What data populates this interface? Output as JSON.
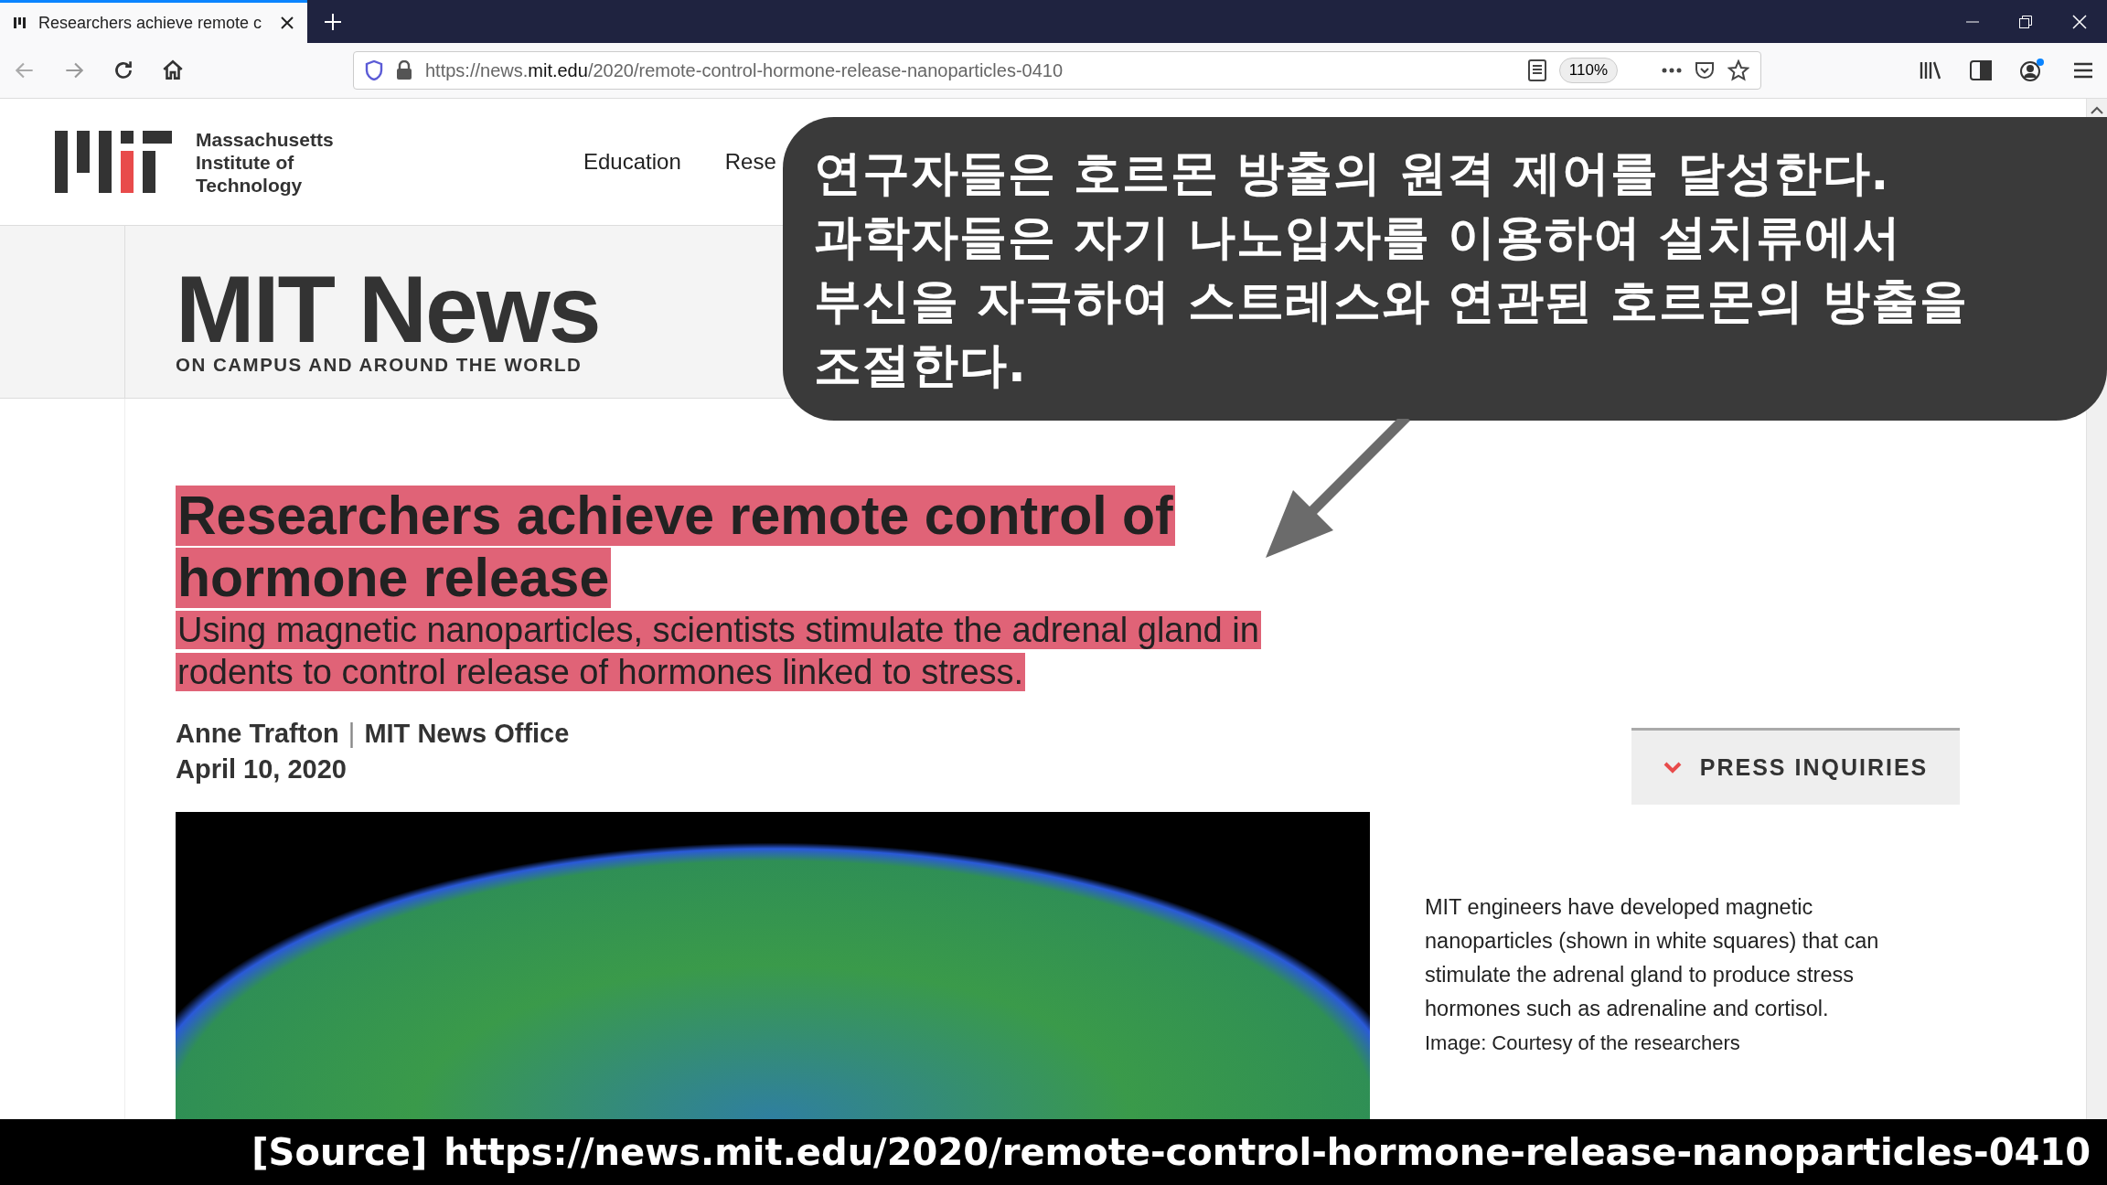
{
  "browser": {
    "tab": {
      "title": "Researchers achieve remote c",
      "selected": true
    },
    "url": "https://news.**mit.edu**/2020/remote-control-hormone-release-nanoparticles-0410",
    "zoom": "110%"
  },
  "page": {
    "logo_text": [
      "Massachusetts",
      "Institute of",
      "Technology"
    ],
    "nav": [
      "Education",
      "Rese"
    ],
    "masthead": {
      "title": "MIT News",
      "tagline": "ON CAMPUS AND AROUND THE WORLD"
    },
    "headline": "Researchers achieve remote control of hormone release",
    "subtitle": "Using magnetic nanoparticles, scientists stimulate the adrenal gland in rodents to control release of hormones linked to stress.",
    "author": "Anne Trafton",
    "separator": "|",
    "office": "MIT News Office",
    "date": "April 10, 2020",
    "press_button": "PRESS INQUIRIES",
    "image_caption": "MIT engineers have developed magnetic nanoparticles (shown in white squares) that can stimulate the adrenal gland to produce stress hormones such as adrenaline and cortisol.",
    "image_credit": "Image: Courtesy of the researchers"
  },
  "callout": {
    "lines": [
      "연구자들은 호르몬 방출의 원격 제어를 달성한다.",
      "과학자들은 자기 나노입자를 이용하여 설치류에서",
      "부신을 자극하여 스트레스와 연관된 호르몬의 방출을",
      "조절한다."
    ]
  },
  "source": {
    "label": "[Source]",
    "url": "https://news.mit.edu/2020/remote-control-hormone-release-nanoparticles-0410"
  }
}
